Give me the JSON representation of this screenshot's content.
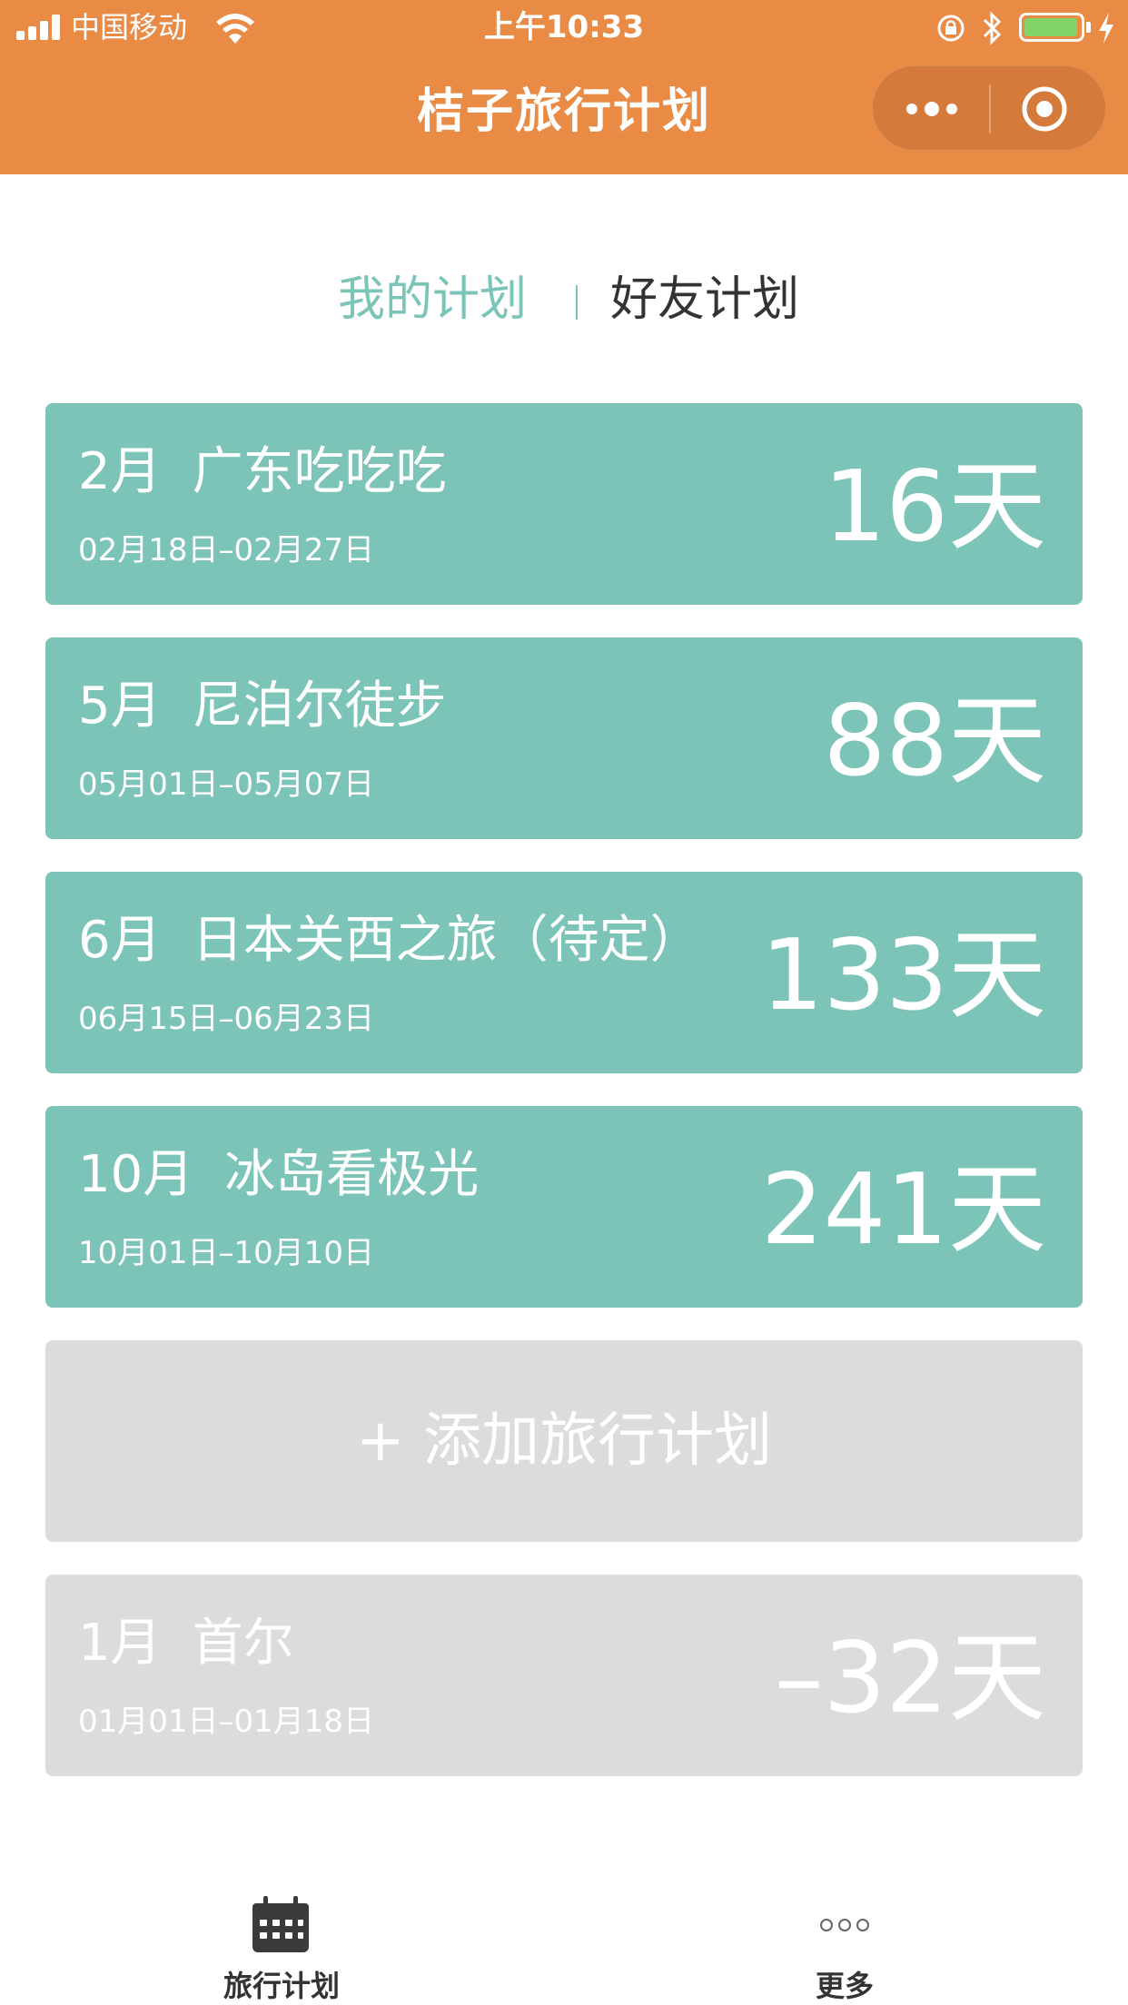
{
  "status_bar": {
    "carrier": "中国移动",
    "time": "上午10:33"
  },
  "nav": {
    "title": "桔子旅行计划",
    "accent_color": "#E98A45"
  },
  "tabs": {
    "mine": "我的计划",
    "friends": "好友计划",
    "active": "mine"
  },
  "plans": [
    {
      "title_month": "2月",
      "title_name": "广东吃吃吃",
      "dates": "02月18日–02月27日",
      "days": "16天",
      "status": "upcoming"
    },
    {
      "title_month": "5月",
      "title_name": "尼泊尔徒步",
      "dates": "05月01日–05月07日",
      "days": "88天",
      "status": "upcoming"
    },
    {
      "title_month": "6月",
      "title_name": "日本关西之旅（待定）",
      "dates": "06月15日–06月23日",
      "days": "133天",
      "status": "upcoming"
    },
    {
      "title_month": "10月",
      "title_name": "冰岛看极光",
      "dates": "10月01日–10月10日",
      "days": "241天",
      "status": "upcoming"
    }
  ],
  "add_plan_label": "+ 添加旅行计划",
  "past_plans": [
    {
      "title_month": "1月",
      "title_name": "首尔",
      "dates": "01月01日–01月18日",
      "days": "–32天",
      "status": "past"
    }
  ],
  "tabbar": {
    "plans_label": "旅行计划",
    "plans_icon": "calendar-icon",
    "more_label": "更多",
    "more_icon": "more-dots-icon"
  },
  "colors": {
    "card_active": "#7CC4B8",
    "card_past": "#DCDCDC",
    "tab_active": "#7BC4B8"
  }
}
